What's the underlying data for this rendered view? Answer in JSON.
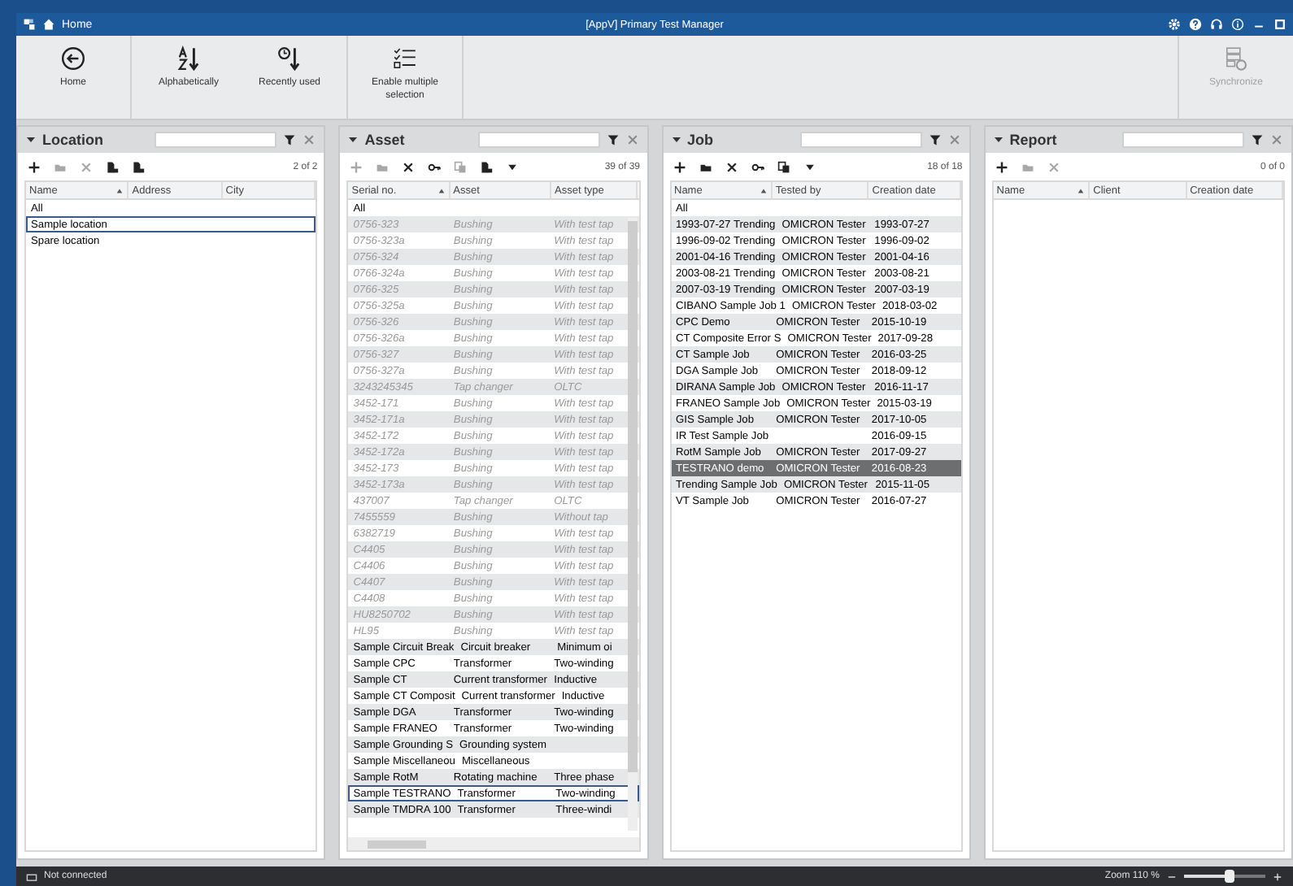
{
  "window": {
    "breadcrumb": "Home",
    "title": "[AppV] Primary Test Manager"
  },
  "ribbon": [
    {
      "kind": "back",
      "label": "Home",
      "disabled": false
    },
    {
      "kind": "alpha",
      "label": "Alphabetically",
      "disabled": false
    },
    {
      "kind": "recent",
      "label": "Recently used",
      "disabled": false
    },
    {
      "kind": "multi",
      "label": "Enable multiple selection",
      "disabled": false
    },
    {
      "kind": "sync",
      "label": "Synchronize",
      "disabled": true
    }
  ],
  "panels": [
    {
      "title": "Location",
      "count": "2 of 2",
      "tools": [
        {
          "kind": "add",
          "disabled": false
        },
        {
          "kind": "open",
          "disabled": true
        },
        {
          "kind": "delete",
          "disabled": true
        },
        {
          "kind": "import",
          "disabled": false
        },
        {
          "kind": "export",
          "disabled": false
        }
      ],
      "columns": [
        "Name",
        "Address",
        "City"
      ],
      "rows": [
        {
          "cells": [
            "All"
          ],
          "focused": false,
          "inactive": false
        },
        {
          "cells": [
            "Sample location"
          ],
          "focused": true,
          "inactive": false
        },
        {
          "cells": [
            "Spare location"
          ],
          "focused": false,
          "inactive": false
        }
      ]
    },
    {
      "title": "Asset",
      "count": "39 of 39",
      "tools": [
        {
          "kind": "add",
          "disabled": true
        },
        {
          "kind": "open",
          "disabled": true
        },
        {
          "kind": "delete",
          "disabled": false
        },
        {
          "kind": "key",
          "disabled": false
        },
        {
          "kind": "copy",
          "disabled": true
        },
        {
          "kind": "import",
          "disabled": false
        },
        {
          "kind": "more",
          "disabled": false
        }
      ],
      "columns": [
        "Serial no.",
        "Asset",
        "Asset type"
      ],
      "rows": [
        {
          "cells": [
            "All"
          ],
          "focused": false,
          "inactive": false
        },
        {
          "cells": [
            "0756-323",
            "Bushing",
            "With test tap"
          ],
          "focused": false,
          "inactive": true
        },
        {
          "cells": [
            "0756-323a",
            "Bushing",
            "With test tap"
          ],
          "focused": false,
          "inactive": true
        },
        {
          "cells": [
            "0756-324",
            "Bushing",
            "With test tap"
          ],
          "focused": false,
          "inactive": true
        },
        {
          "cells": [
            "0766-324a",
            "Bushing",
            "With test tap"
          ],
          "focused": false,
          "inactive": true
        },
        {
          "cells": [
            "0766-325",
            "Bushing",
            "With test tap"
          ],
          "focused": false,
          "inactive": true
        },
        {
          "cells": [
            "0756-325a",
            "Bushing",
            "With test tap"
          ],
          "focused": false,
          "inactive": true
        },
        {
          "cells": [
            "0756-326",
            "Bushing",
            "With test tap"
          ],
          "focused": false,
          "inactive": true
        },
        {
          "cells": [
            "0756-326a",
            "Bushing",
            "With test tap"
          ],
          "focused": false,
          "inactive": true
        },
        {
          "cells": [
            "0756-327",
            "Bushing",
            "With test tap"
          ],
          "focused": false,
          "inactive": true
        },
        {
          "cells": [
            "0756-327a",
            "Bushing",
            "With test tap"
          ],
          "focused": false,
          "inactive": true
        },
        {
          "cells": [
            "3243245345",
            "Tap changer",
            "OLTC"
          ],
          "focused": false,
          "inactive": true
        },
        {
          "cells": [
            "3452-171",
            "Bushing",
            "With test tap"
          ],
          "focused": false,
          "inactive": true
        },
        {
          "cells": [
            "3452-171a",
            "Bushing",
            "With test tap"
          ],
          "focused": false,
          "inactive": true
        },
        {
          "cells": [
            "3452-172",
            "Bushing",
            "With test tap"
          ],
          "focused": false,
          "inactive": true
        },
        {
          "cells": [
            "3452-172a",
            "Bushing",
            "With test tap"
          ],
          "focused": false,
          "inactive": true
        },
        {
          "cells": [
            "3452-173",
            "Bushing",
            "With test tap"
          ],
          "focused": false,
          "inactive": true
        },
        {
          "cells": [
            "3452-173a",
            "Bushing",
            "With test tap"
          ],
          "focused": false,
          "inactive": true
        },
        {
          "cells": [
            "437007",
            "Tap changer",
            "OLTC"
          ],
          "focused": false,
          "inactive": true
        },
        {
          "cells": [
            "7455559",
            "Bushing",
            "Without tap"
          ],
          "focused": false,
          "inactive": true
        },
        {
          "cells": [
            "6382719",
            "Bushing",
            "With test tap"
          ],
          "focused": false,
          "inactive": true
        },
        {
          "cells": [
            "C4405",
            "Bushing",
            "With test tap"
          ],
          "focused": false,
          "inactive": true
        },
        {
          "cells": [
            "C4406",
            "Bushing",
            "With test tap"
          ],
          "focused": false,
          "inactive": true
        },
        {
          "cells": [
            "C4407",
            "Bushing",
            "With test tap"
          ],
          "focused": false,
          "inactive": true
        },
        {
          "cells": [
            "C4408",
            "Bushing",
            "With test tap"
          ],
          "focused": false,
          "inactive": true
        },
        {
          "cells": [
            "HU8250702",
            "Bushing",
            "With test tap"
          ],
          "focused": false,
          "inactive": true
        },
        {
          "cells": [
            "HL95",
            "Bushing",
            "With test tap"
          ],
          "focused": false,
          "inactive": true
        },
        {
          "cells": [
            "Sample Circuit Break",
            "Circuit breaker",
            "Minimum oi"
          ],
          "focused": false,
          "inactive": false
        },
        {
          "cells": [
            "Sample CPC",
            "Transformer",
            "Two-winding"
          ],
          "focused": false,
          "inactive": false
        },
        {
          "cells": [
            "Sample CT",
            "Current transformer",
            "Inductive"
          ],
          "focused": false,
          "inactive": false
        },
        {
          "cells": [
            "Sample CT Composit",
            "Current transformer",
            "Inductive"
          ],
          "focused": false,
          "inactive": false
        },
        {
          "cells": [
            "Sample DGA",
            "Transformer",
            "Two-winding"
          ],
          "focused": false,
          "inactive": false
        },
        {
          "cells": [
            "Sample FRANEO",
            "Transformer",
            "Two-winding"
          ],
          "focused": false,
          "inactive": false
        },
        {
          "cells": [
            "Sample Grounding S",
            "Grounding system"
          ],
          "focused": false,
          "inactive": false
        },
        {
          "cells": [
            "Sample Miscellaneou",
            "Miscellaneous"
          ],
          "focused": false,
          "inactive": false
        },
        {
          "cells": [
            "Sample RotM",
            "Rotating machine",
            "Three phase"
          ],
          "focused": false,
          "inactive": false
        },
        {
          "cells": [
            "Sample TESTRANO",
            "Transformer",
            "Two-winding"
          ],
          "focused": true,
          "inactive": false
        },
        {
          "cells": [
            "Sample TMDRA 100",
            "Transformer",
            "Three-windi"
          ],
          "focused": false,
          "inactive": false
        }
      ]
    },
    {
      "title": "Job",
      "count": "18 of 18",
      "tools": [
        {
          "kind": "add",
          "disabled": false
        },
        {
          "kind": "open",
          "disabled": false
        },
        {
          "kind": "delete",
          "disabled": false
        },
        {
          "kind": "key",
          "disabled": false
        },
        {
          "kind": "copy",
          "disabled": false
        },
        {
          "kind": "more",
          "disabled": false
        }
      ],
      "columns": [
        "Name",
        "Tested by",
        "Creation date"
      ],
      "rows": [
        {
          "cells": [
            "All"
          ],
          "selected": false,
          "inactive": false
        },
        {
          "cells": [
            "1993-07-27 Trending",
            "OMICRON Tester",
            "1993-07-27"
          ],
          "selected": false,
          "inactive": false
        },
        {
          "cells": [
            "1996-09-02 Trending",
            "OMICRON Tester",
            "1996-09-02"
          ],
          "selected": false,
          "inactive": false
        },
        {
          "cells": [
            "2001-04-16 Trending",
            "OMICRON Tester",
            "2001-04-16"
          ],
          "selected": false,
          "inactive": false
        },
        {
          "cells": [
            "2003-08-21 Trending",
            "OMICRON Tester",
            "2003-08-21"
          ],
          "selected": false,
          "inactive": false
        },
        {
          "cells": [
            "2007-03-19 Trending",
            "OMICRON Tester",
            "2007-03-19"
          ],
          "selected": false,
          "inactive": false
        },
        {
          "cells": [
            "CIBANO Sample Job 1",
            "OMICRON Tester",
            "2018-03-02"
          ],
          "selected": false,
          "inactive": false
        },
        {
          "cells": [
            "CPC Demo",
            "OMICRON Tester",
            "2015-10-19"
          ],
          "selected": false,
          "inactive": false
        },
        {
          "cells": [
            "CT Composite Error S",
            "OMICRON Tester",
            "2017-09-28"
          ],
          "selected": false,
          "inactive": false
        },
        {
          "cells": [
            "CT Sample Job",
            "OMICRON Tester",
            "2016-03-25"
          ],
          "selected": false,
          "inactive": false
        },
        {
          "cells": [
            "DGA Sample Job",
            "OMICRON Tester",
            "2018-09-12"
          ],
          "selected": false,
          "inactive": false
        },
        {
          "cells": [
            "DIRANA Sample Job",
            "OMICRON Tester",
            "2016-11-17"
          ],
          "selected": false,
          "inactive": false
        },
        {
          "cells": [
            "FRANEO Sample Job",
            "OMICRON Tester",
            "2015-03-19"
          ],
          "selected": false,
          "inactive": false
        },
        {
          "cells": [
            "GIS Sample Job",
            "OMICRON Tester",
            "2017-10-05"
          ],
          "selected": false,
          "inactive": false
        },
        {
          "cells": [
            "IR Test Sample Job",
            "",
            "2016-09-15"
          ],
          "selected": false,
          "inactive": false
        },
        {
          "cells": [
            "RotM Sample Job",
            "OMICRON Tester",
            "2017-09-27"
          ],
          "selected": false,
          "inactive": false
        },
        {
          "cells": [
            "TESTRANO demo",
            "OMICRON Tester",
            "2016-08-23"
          ],
          "selected": true,
          "inactive": false
        },
        {
          "cells": [
            "Trending Sample Job",
            "OMICRON Tester",
            "2015-11-05"
          ],
          "selected": false,
          "inactive": false
        },
        {
          "cells": [
            "VT Sample Job",
            "OMICRON Tester",
            "2016-07-27"
          ],
          "selected": false,
          "inactive": false
        }
      ]
    },
    {
      "title": "Report",
      "count": "0 of 0",
      "tools": [
        {
          "kind": "add",
          "disabled": false
        },
        {
          "kind": "open",
          "disabled": true
        },
        {
          "kind": "delete",
          "disabled": true
        }
      ],
      "columns": [
        "Name",
        "Client",
        "Creation date"
      ]
    }
  ],
  "status_bar": {
    "connection": "Not connected",
    "zoom": "Zoom 110 %",
    "zoom_level": {
      "level": 0.55
    }
  }
}
